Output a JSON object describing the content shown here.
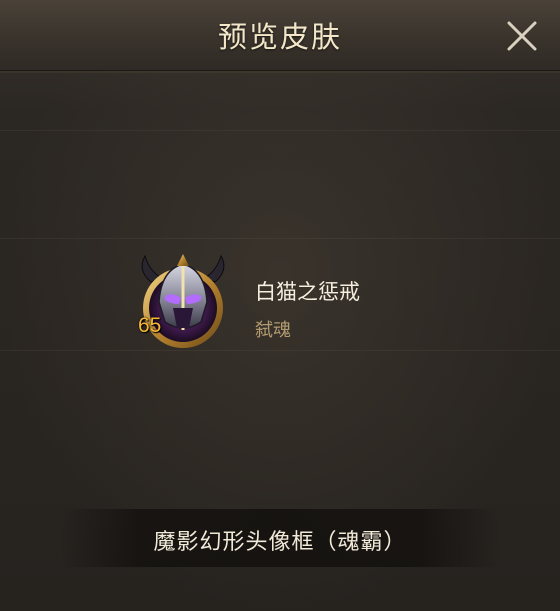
{
  "dialog": {
    "title": "预览皮肤",
    "close_icon": "close-icon"
  },
  "item": {
    "name": "白猫之惩戒",
    "subtitle": "弑魂",
    "level": "65",
    "icon": "horned-helmet-avatar-frame"
  },
  "footer": {
    "label": "魔影幻形头像框（魂霸）"
  },
  "colors": {
    "title": "#f3e7c9",
    "level": "#f6b737",
    "subtitle": "#b39a70"
  }
}
